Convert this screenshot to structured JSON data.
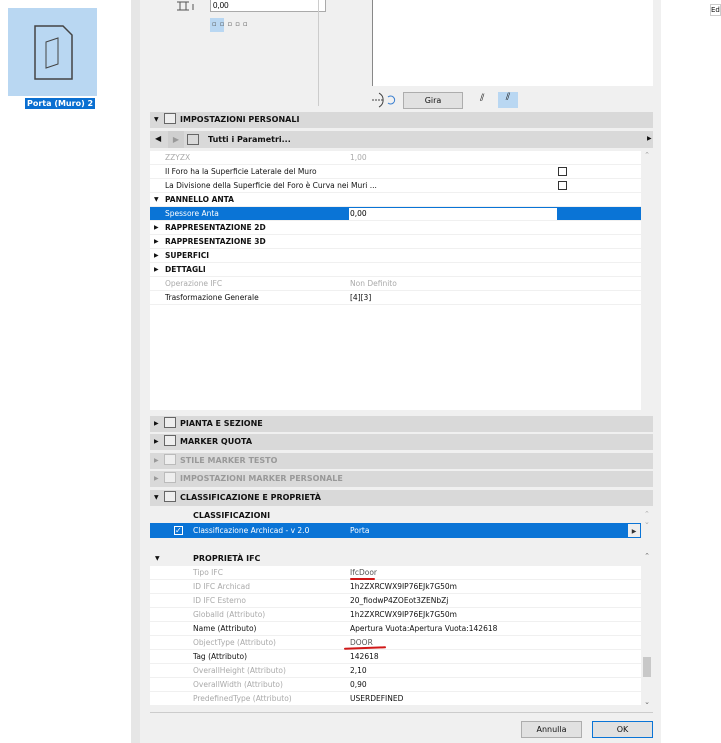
{
  "left_panel": {
    "item_label": "Porta (Muro) 2",
    "item_icon": "door-file-icon"
  },
  "top": {
    "offset_value": "0,00",
    "rotate_button": "Gira"
  },
  "right_pane": {
    "label": "Ed"
  },
  "personal_settings": {
    "title": "IMPOSTAZIONI PERSONALI",
    "nav_label": "Tutti i Parametri...",
    "rows": [
      {
        "k": "ZZYZX",
        "v": "1,00",
        "style": "disabled"
      },
      {
        "k": "Il Foro ha la Superficie Laterale del Muro",
        "v": "",
        "checkbox": true
      },
      {
        "k": "La Divisione della Superficie del Foro è Curva nei Muri ...",
        "v": "",
        "checkbox": true
      },
      {
        "k": "PANNELLO ANTA",
        "group": true,
        "open": true
      },
      {
        "k": "Spessore Anta",
        "v": "0,00",
        "selected": true
      },
      {
        "k": "RAPPRESENTAZIONE 2D",
        "group": true
      },
      {
        "k": "RAPPRESENTAZIONE 3D",
        "group": true
      },
      {
        "k": "SUPERFICI",
        "group": true
      },
      {
        "k": "DETTAGLI",
        "group": true
      },
      {
        "k": "Operazione IFC",
        "v": "Non Definito",
        "style": "disabled"
      },
      {
        "k": "Trasformazione Generale",
        "v": "[4][3]"
      }
    ]
  },
  "sections": [
    {
      "title": "PIANTA E SEZIONE",
      "enabled": true
    },
    {
      "title": "MARKER QUOTA",
      "enabled": true
    },
    {
      "title": "STILE MARKER TESTO",
      "enabled": false
    },
    {
      "title": "IMPOSTAZIONI MARKER PERSONALE",
      "enabled": false
    },
    {
      "title": "CLASSIFICAZIONE E PROPRIETÀ",
      "enabled": true
    }
  ],
  "classification": {
    "header": "CLASSIFICAZIONI",
    "system": "Classificazione Archicad - v 2.0",
    "value": "Porta"
  },
  "ifc": {
    "header": "PROPRIETÀ IFC",
    "rows": [
      {
        "k": "Tipo IFC",
        "v": "IfcDoor",
        "dim": true
      },
      {
        "k": "ID IFC Archicad",
        "v": "1h2ZXRCWX9IP76EJk7G50m",
        "dim": true
      },
      {
        "k": "ID IFC Esterno",
        "v": "20_fiodwP4ZOEot3ZENbZj",
        "dim": true
      },
      {
        "k": "GlobalId (Attributo)",
        "v": "1h2ZXRCWX9IP76EJk7G50m",
        "dim": true
      },
      {
        "k": "Name (Attributo)",
        "v": "Apertura Vuota:Apertura Vuota:142618",
        "dim": false
      },
      {
        "k": "ObjectType (Attributo)",
        "v": "DOOR",
        "dim": true
      },
      {
        "k": "Tag (Attributo)",
        "v": "142618",
        "dim": false
      },
      {
        "k": "OverallHeight (Attributo)",
        "v": "2,10",
        "dim": true
      },
      {
        "k": "OverallWidth (Attributo)",
        "v": "0,90",
        "dim": true
      },
      {
        "k": "PredefinedType (Attributo)",
        "v": "USERDEFINED",
        "dim": true
      }
    ]
  },
  "buttons": {
    "cancel": "Annulla",
    "ok": "OK"
  }
}
